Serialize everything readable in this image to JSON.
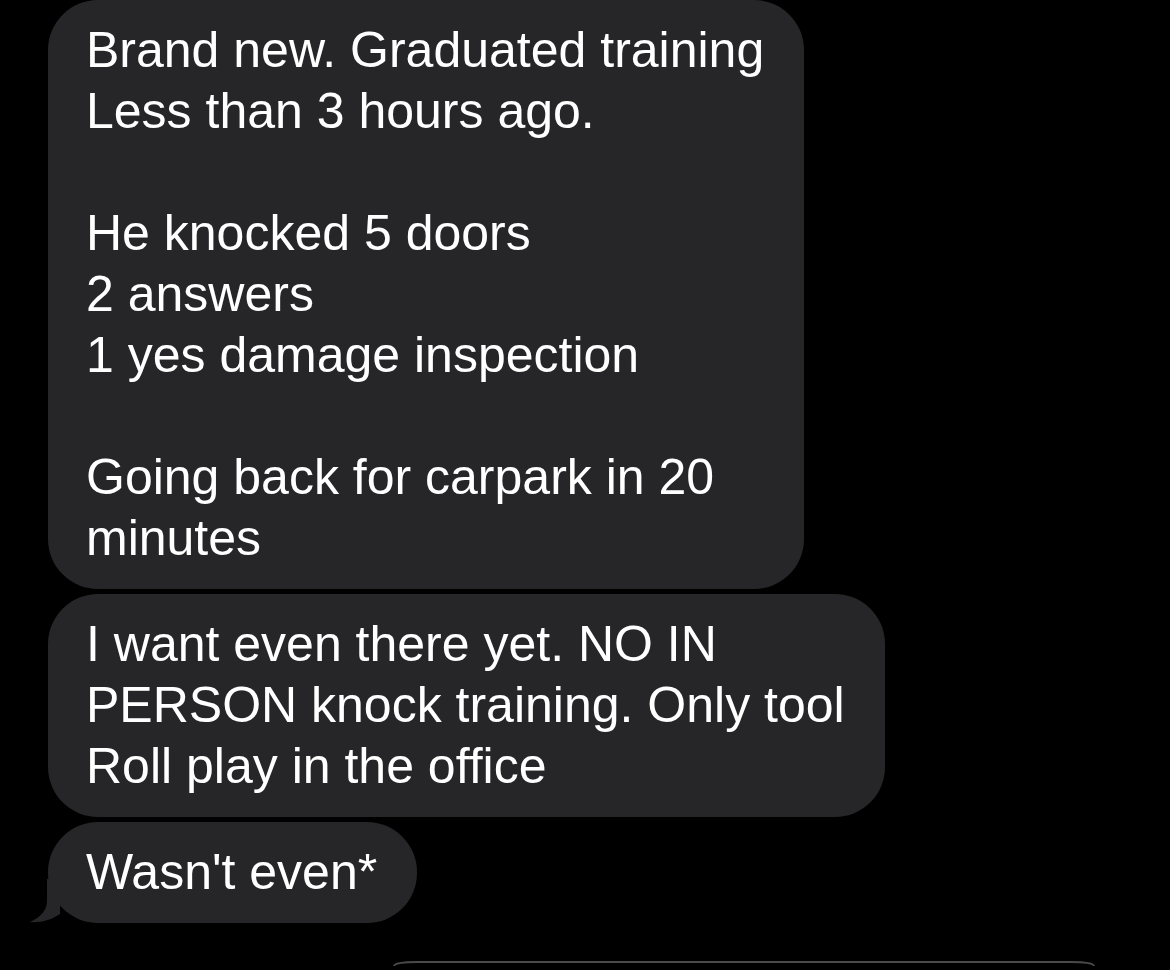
{
  "messages": [
    {
      "text": "Brand new. Graduated training\nLess than 3 hours ago.\n\nHe knocked 5 doors\n2 answers\n1 yes damage inspection\n\nGoing back for carpark in 20\nminutes",
      "tail": false
    },
    {
      "text": "I want even there yet. NO IN\nPERSON knock training. Only tool\nRoll play in the office",
      "tail": false
    },
    {
      "text": "Wasn't even*",
      "tail": true
    }
  ]
}
